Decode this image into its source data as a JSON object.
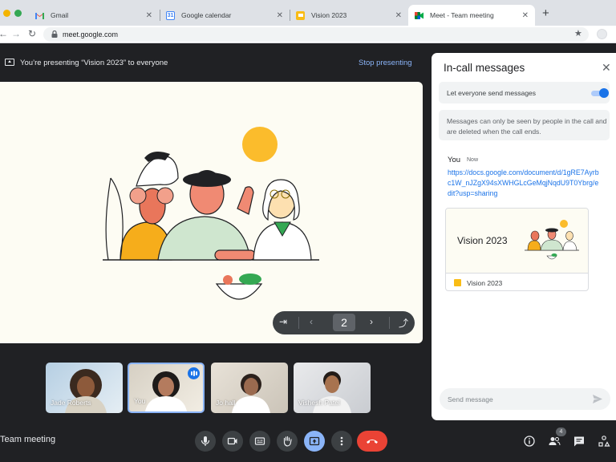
{
  "browser": {
    "tabs": [
      {
        "label": "Gmail",
        "icon": "gmail-icon"
      },
      {
        "label": "Google calendar",
        "icon": "calendar-icon"
      },
      {
        "label": "Vision 2023",
        "icon": "slides-icon"
      },
      {
        "label": "Meet - Team meeting",
        "icon": "meet-icon"
      }
    ],
    "calendar_favicon_text": "31",
    "url": "meet.google.com"
  },
  "presenting": {
    "text": "You’re presenting “Vision 2023” to everyone",
    "stop_label": "Stop presenting"
  },
  "slide": {
    "page_number": "2"
  },
  "participants": [
    {
      "name": "Jade Roberts"
    },
    {
      "name": "You"
    },
    {
      "name": "Jo hall"
    },
    {
      "name": "Vishesh Patel"
    }
  ],
  "meeting": {
    "name": "Team meeting",
    "people_count": "4"
  },
  "chat": {
    "title": "In-call messages",
    "allow_label": "Let everyone send messages",
    "allow_enabled": true,
    "note": "Messages can only be seen by people in the call and are deleted when the call ends.",
    "messages": [
      {
        "sender": "You",
        "time": "Now",
        "link": "https://docs.google.com/document/d/1gRE7Ayrbc1W_nJZgX94sXWHGLcGeMqjNqdU9T0Ybrg/edit?usp=sharing",
        "attachment": {
          "slide_title": "Vision 2023",
          "name": "Vision 2023"
        }
      }
    ],
    "input_placeholder": "Send message"
  },
  "colors": {
    "accent": "#1a73e8",
    "end_call": "#ea4335",
    "background": "#202124"
  }
}
